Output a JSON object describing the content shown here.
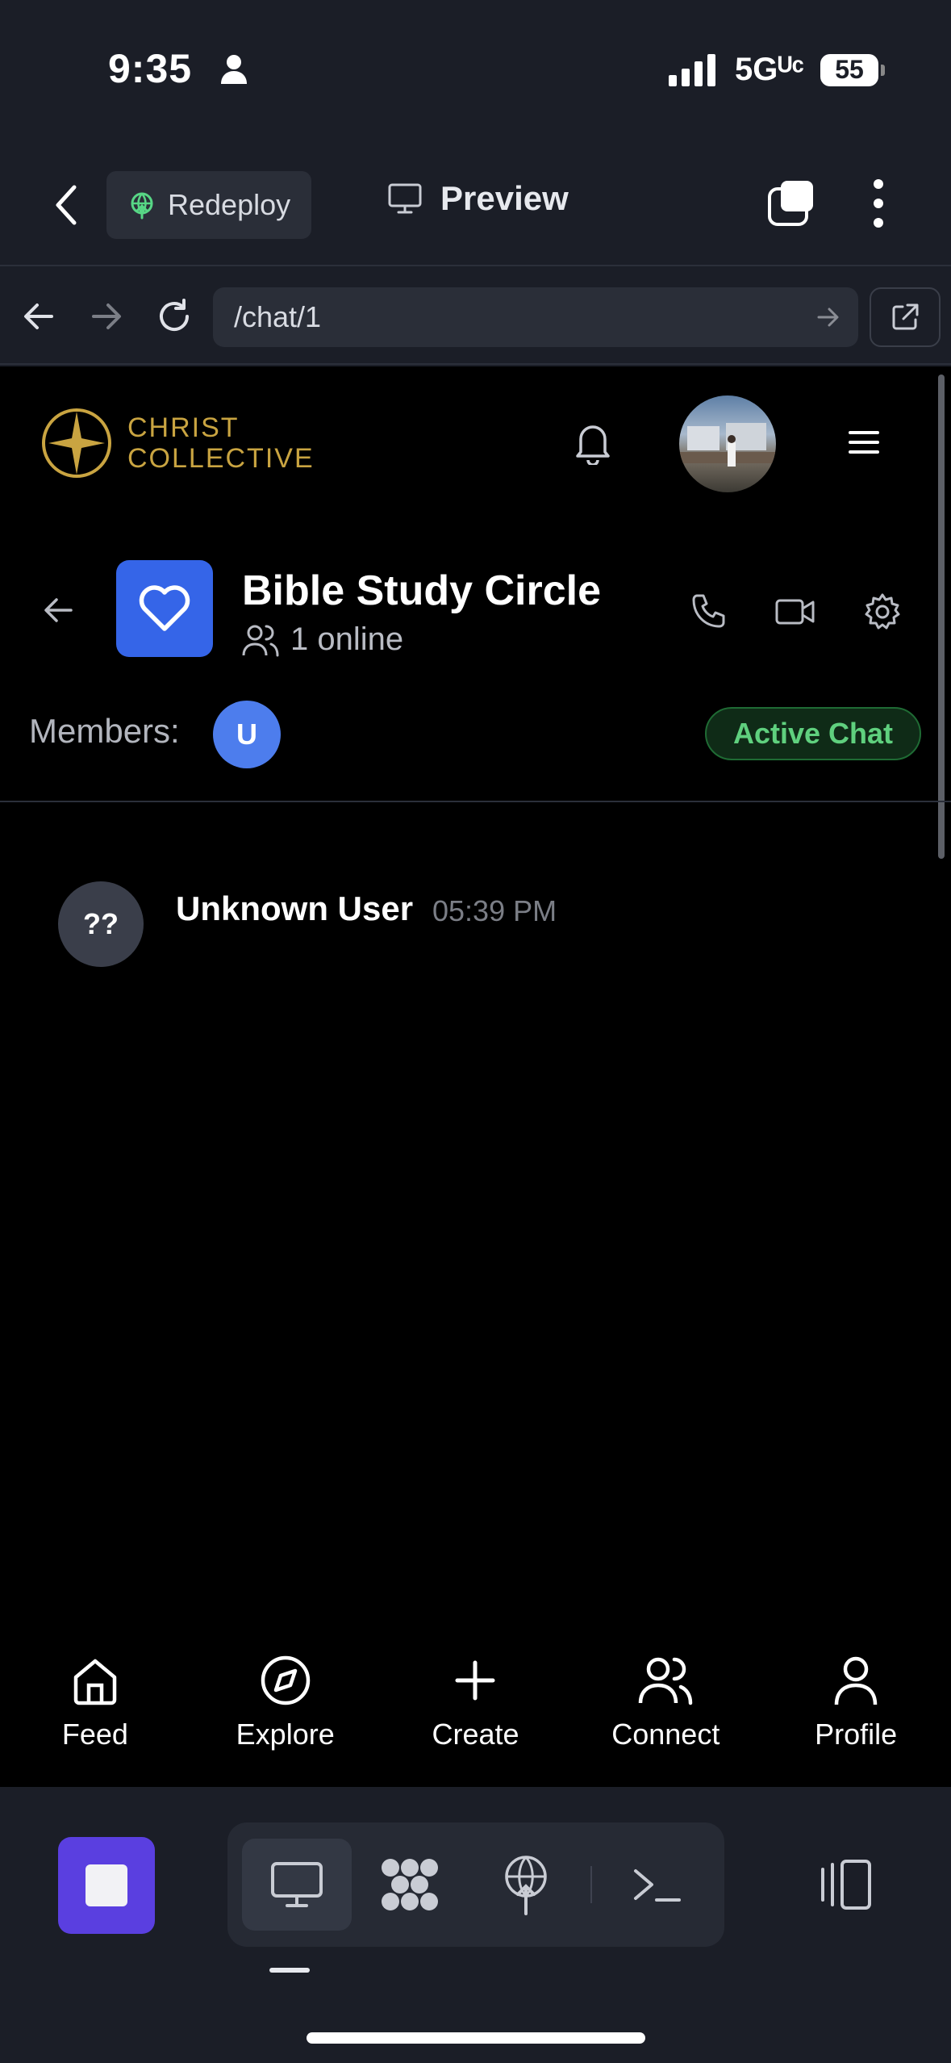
{
  "status_bar": {
    "time": "9:35",
    "network": "5Gᵁᶜ",
    "battery": "55"
  },
  "toolbar": {
    "redeploy_label": "Redeploy",
    "preview_label": "Preview"
  },
  "browser": {
    "url": "/chat/1"
  },
  "site": {
    "logo_line1": "CHRIST",
    "logo_line2": "COLLECTIVE"
  },
  "chat": {
    "title": "Bible Study Circle",
    "online": "1 online",
    "members_label": "Members:",
    "member_initial": "U",
    "status_badge": "Active Chat",
    "messages": [
      {
        "avatar": "??",
        "author": "Unknown User",
        "time": "05:39 PM"
      }
    ]
  },
  "bottom_nav": {
    "items": [
      {
        "label": "Feed",
        "icon": "home-icon"
      },
      {
        "label": "Explore",
        "icon": "compass-icon"
      },
      {
        "label": "Create",
        "icon": "plus-icon"
      },
      {
        "label": "Connect",
        "icon": "users-icon"
      },
      {
        "label": "Profile",
        "icon": "user-icon"
      }
    ]
  },
  "colors": {
    "accent_gold": "#c9a441",
    "brand_blue": "#3565e8",
    "active_green": "#5fd07e",
    "stop_purple": "#5a3fe0"
  }
}
